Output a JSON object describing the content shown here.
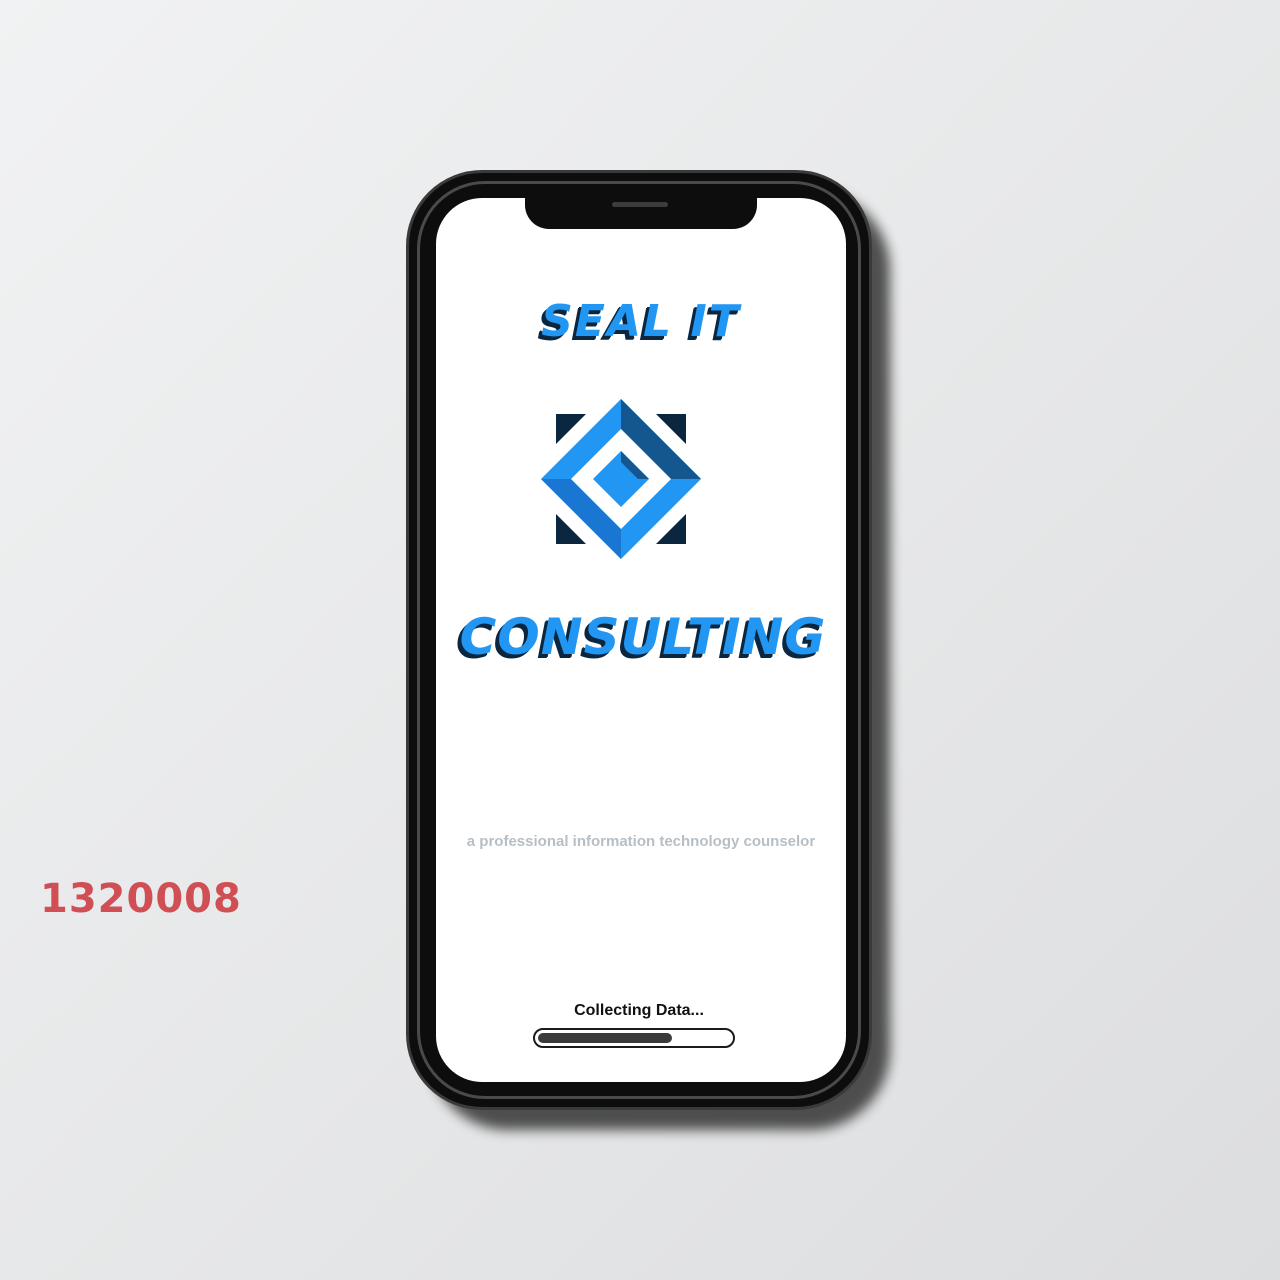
{
  "overlay_id": "1320008",
  "app": {
    "brand_line_1": "SEAL IT",
    "brand_line_2": "CONSULTING",
    "tagline": "a professional information technology counselor",
    "status_text": "Collecting Data...",
    "progress_fraction": 0.7
  },
  "icons": {
    "logo": "diamond-logo-icon"
  },
  "colors": {
    "brand_blue": "#2196f3",
    "brand_dark": "#0b2740",
    "tagline_gray": "#b7bfc6",
    "id_label_red": "#cf4f55"
  }
}
